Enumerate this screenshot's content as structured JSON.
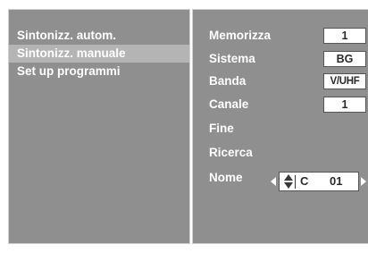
{
  "menu": {
    "items": [
      {
        "label": "Sintonizz. autom."
      },
      {
        "label": "Sintonizz. manuale"
      },
      {
        "label": "Set up programmi"
      }
    ]
  },
  "settings": {
    "memorizza": {
      "label": "Memorizza",
      "value": "1"
    },
    "sistema": {
      "label": "Sistema",
      "value": "BG"
    },
    "banda": {
      "label": "Banda",
      "value": "V/UHF"
    },
    "canale": {
      "label": "Canale",
      "value": "1"
    },
    "fine": {
      "label": "Fine"
    },
    "ricerca": {
      "label": "Ricerca"
    },
    "nome": {
      "label": "Nome",
      "letter": "C",
      "number": "01"
    }
  },
  "icons": {
    "name_prev": "left-arrow-icon",
    "name_next": "right-arrow-icon",
    "name_updown": "up-down-arrows-icon"
  },
  "colors": {
    "panel_bg": "#8f8f8f",
    "selected_bg": "#b4b4b4",
    "text": "#ffffff",
    "value_bg": "#ffffff"
  }
}
